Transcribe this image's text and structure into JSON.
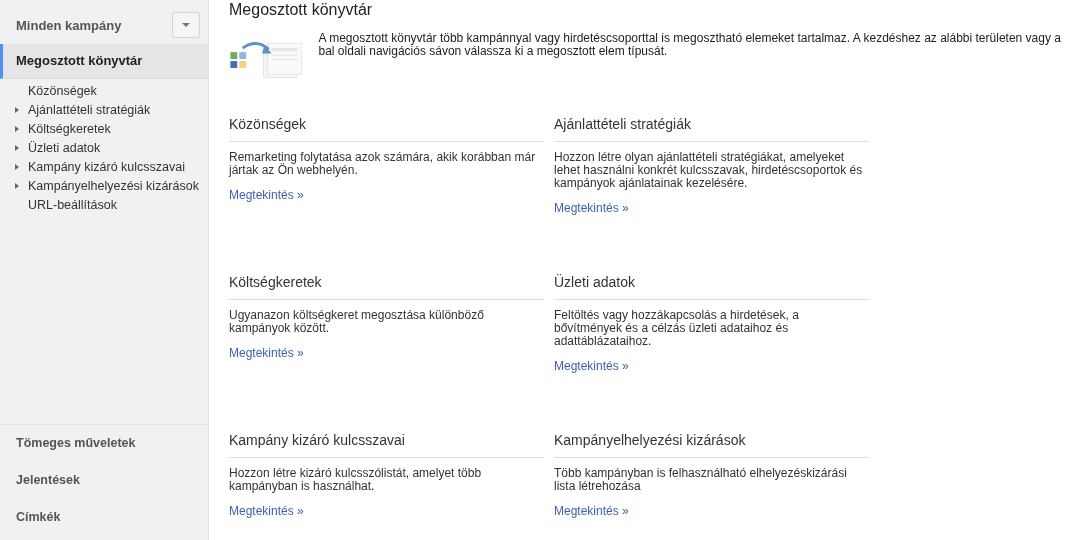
{
  "sidebar": {
    "campaign_selector": {
      "label": "Minden kampány"
    },
    "section": {
      "label": "Megosztott könyvtár",
      "selected": true
    },
    "items": [
      {
        "label": "Közönségek",
        "kind": "leaf"
      },
      {
        "label": "Ajánlattételi stratégiák",
        "kind": "expandable"
      },
      {
        "label": "Költségkeretek",
        "kind": "expandable"
      },
      {
        "label": "Üzleti adatok",
        "kind": "expandable"
      },
      {
        "label": "Kampány kizáró kulcsszavai",
        "kind": "expandable"
      },
      {
        "label": "Kampányelhelyezési kizárások",
        "kind": "expandable"
      },
      {
        "label": "URL-beállítások",
        "kind": "leaf"
      }
    ],
    "bottom_links": [
      "Tömeges műveletek",
      "Jelentések",
      "Címkék"
    ]
  },
  "page": {
    "title": "Megosztott könyvtár",
    "intro": "A megosztott könyvtár több kampánnyal vagy hirdetéscsoporttal is megosztható elemeket tartalmaz. A kezdéshez az alábbi területen vagy a bal oldali navigációs sávon válassza ki a megosztott elem típusát.",
    "cards": [
      {
        "title": "Közönségek",
        "description": "Remarketing folytatása azok számára, akik korábban már jártak az Ön webhelyén.",
        "link": "Megtekintés »"
      },
      {
        "title": "Ajánlattételi stratégiák",
        "description": "Hozzon létre olyan ajánlattételi stratégiákat, amelyeket lehet használni konkrét kulcsszavak, hirdetéscsoportok és kampányok ajánlatainak kezelésére.",
        "link": "Megtekintés »"
      },
      {
        "title": "Költségkeretek",
        "description": "Ugyanazon költségkeret megosztása különböző kampányok között.",
        "link": "Megtekintés »"
      },
      {
        "title": "Üzleti adatok",
        "description": "Feltöltés vagy hozzákapcsolás a hirdetések, a bővítmények és a célzás üzleti adataihoz és adattáblázataihoz.",
        "link": "Megtekintés »"
      },
      {
        "title": "Kampány kizáró kulcsszavai",
        "description": "Hozzon létre kizáró kulcsszólistát, amelyet több kampányban is használhat.",
        "link": "Megtekintés »"
      },
      {
        "title": "Kampányelhelyezési kizárások",
        "description": "Több kampányban is felhasználható elhelyezéskizárási lista létrehozása",
        "link": "Megtekintés »"
      }
    ]
  }
}
